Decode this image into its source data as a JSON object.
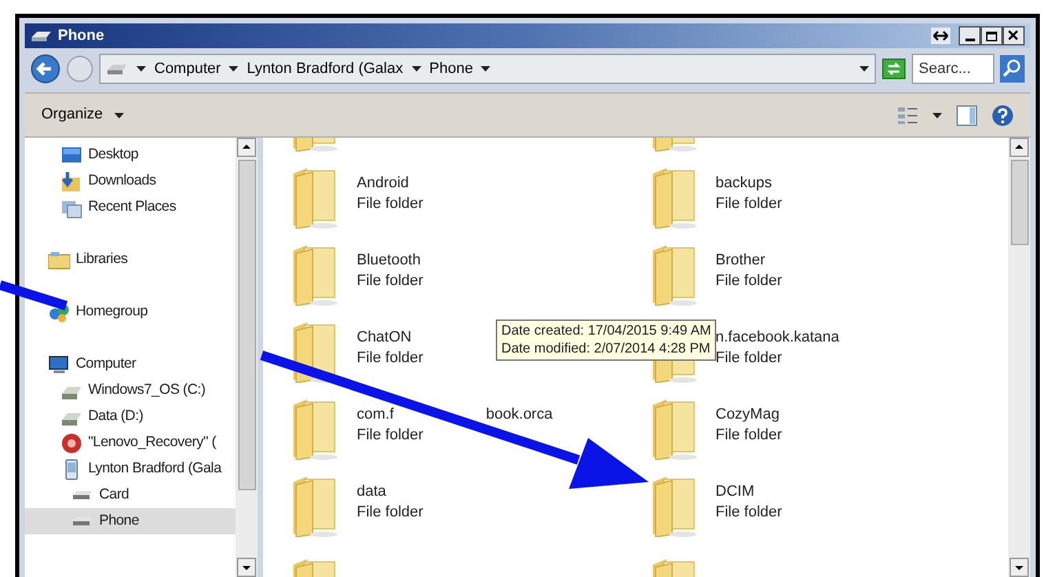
{
  "window": {
    "title": "Phone"
  },
  "address_bar": {
    "breadcrumbs": [
      "Computer",
      "Lynton Bradford (Galax",
      "Phone"
    ]
  },
  "search": {
    "placeholder": "Searc..."
  },
  "toolbar": {
    "organize": "Organize"
  },
  "nav_pane": {
    "favorites": [
      {
        "label": "Desktop",
        "kind": "desktop"
      },
      {
        "label": "Downloads",
        "kind": "downloads"
      },
      {
        "label": "Recent Places",
        "kind": "recent"
      }
    ],
    "sections": [
      {
        "label": "Libraries",
        "kind": "libraries"
      },
      {
        "label": "Homegroup",
        "kind": "homegroup"
      },
      {
        "label": "Computer",
        "kind": "computer",
        "children": [
          {
            "label": "Windows7_OS (C:)",
            "kind": "drive"
          },
          {
            "label": "Data (D:)",
            "kind": "drive"
          },
          {
            "label": "\"Lenovo_Recovery\" (",
            "kind": "recovery"
          },
          {
            "label": "Lynton Bradford (Gala",
            "kind": "device",
            "children": [
              {
                "label": "Card",
                "kind": "storage",
                "selected": false
              },
              {
                "label": "Phone",
                "kind": "storage",
                "selected": true
              }
            ]
          }
        ]
      }
    ]
  },
  "files": [
    {
      "kind": "stub"
    },
    {
      "kind": "stub"
    },
    {
      "name": "Android",
      "type": "File folder"
    },
    {
      "name": "backups",
      "type": "File folder"
    },
    {
      "name": "Bluetooth",
      "type": "File folder"
    },
    {
      "name": "Brother",
      "type": "File folder"
    },
    {
      "name": "ChatON",
      "type": "File folder"
    },
    {
      "name": "n.facebook.katana",
      "type": "File folder"
    },
    {
      "name_parts": [
        "com.f",
        "book.orca"
      ],
      "type": "File folder"
    },
    {
      "name": "CozyMag",
      "type": "File folder"
    },
    {
      "name": "data",
      "type": "File folder"
    },
    {
      "name": "DCIM",
      "type": "File folder"
    },
    {
      "kind": "peek"
    },
    {
      "kind": "peek"
    }
  ],
  "tooltip": {
    "lines": [
      "Date created: 17/04/2015 9:49 AM",
      "Date modified: 2/07/2014 4:28 PM"
    ]
  },
  "annotation": {
    "kind": "arrow"
  }
}
